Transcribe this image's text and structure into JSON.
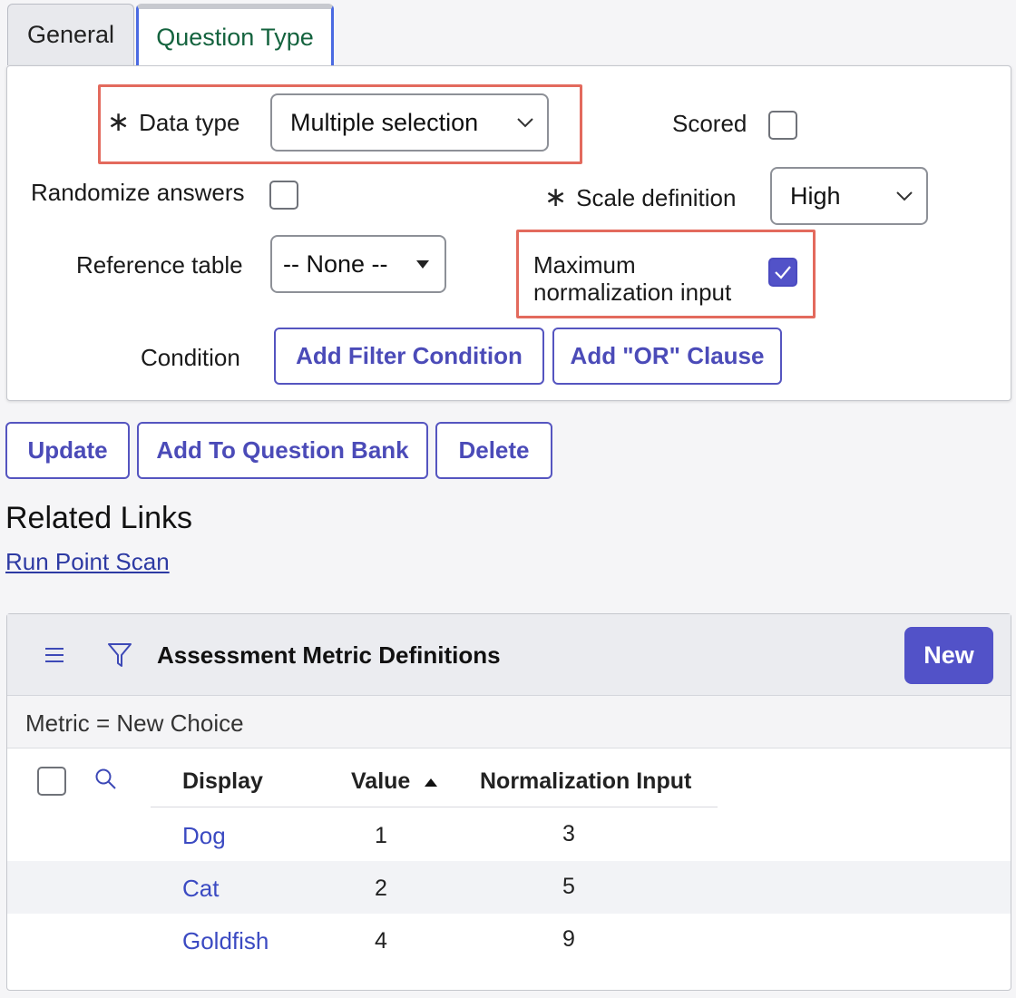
{
  "tabs": {
    "general": "General",
    "question_type": "Question Type"
  },
  "form": {
    "data_type_label": "Data type",
    "data_type_value": "Multiple selection",
    "scored_label": "Scored",
    "scored_checked": false,
    "randomize_label": "Randomize answers",
    "randomize_checked": false,
    "scale_label": "Scale definition",
    "scale_value": "High",
    "reference_label": "Reference table",
    "reference_value": "-- None --",
    "max_norm_label_line1": "Maximum",
    "max_norm_label_line2": "normalization input",
    "max_norm_checked": true,
    "condition_label": "Condition",
    "add_filter_label": "Add Filter Condition",
    "add_or_label": "Add \"OR\" Clause",
    "required_marker": "∗"
  },
  "actions": {
    "update": "Update",
    "add_to_bank": "Add To Question Bank",
    "delete": "Delete"
  },
  "related": {
    "heading": "Related Links",
    "link": "Run Point Scan"
  },
  "list": {
    "title": "Assessment Metric Definitions",
    "new_label": "New",
    "filter_text": "Metric = New Choice",
    "columns": {
      "display": "Display",
      "value": "Value",
      "normalization": "Normalization Input"
    },
    "sort_column": "Value",
    "sort_direction": "ascending",
    "rows": [
      {
        "display": "Dog",
        "value": "1",
        "normalization": "3"
      },
      {
        "display": "Cat",
        "value": "2",
        "normalization": "5"
      },
      {
        "display": "Goldfish",
        "value": "4",
        "normalization": "9"
      }
    ]
  },
  "colors": {
    "accent": "#5252c8",
    "highlight": "#e36a5d",
    "active_tab_text": "#14633e"
  }
}
